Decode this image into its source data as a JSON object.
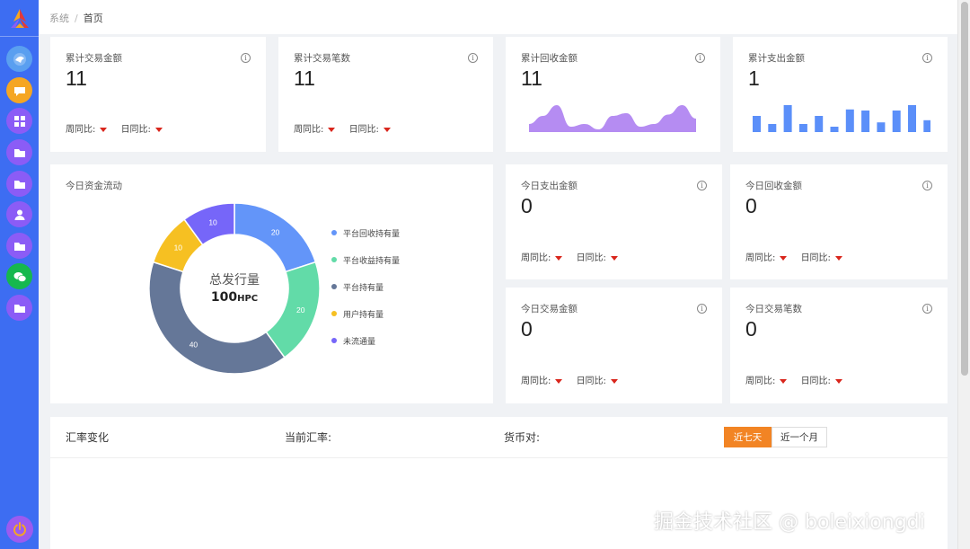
{
  "colors": {
    "sidebar": "#3d6df2",
    "accent_orange": "#f28424",
    "down_arrow": "#d9261c",
    "area_chart": "#b58cf2",
    "bar_chart": "#5b8ff9"
  },
  "sidebar": {
    "items": [
      {
        "icon": "bird-avatar-icon",
        "color": "#5a9ff0"
      },
      {
        "icon": "chat-bubble-icon",
        "color": "#f5a623"
      },
      {
        "icon": "dashboard-grid-icon",
        "color": "#8b5cf6"
      },
      {
        "icon": "folder-icon",
        "color": "#8b5cf6"
      },
      {
        "icon": "folder-icon",
        "color": "#8b5cf6"
      },
      {
        "icon": "user-icon",
        "color": "#8b5cf6"
      },
      {
        "icon": "folder-icon",
        "color": "#8b5cf6"
      },
      {
        "icon": "wechat-icon",
        "color": "#16b84e"
      },
      {
        "icon": "folder-icon",
        "color": "#8b5cf6"
      }
    ],
    "power_icon": "power-icon"
  },
  "breadcrumb": {
    "root": "系统",
    "sep": "/",
    "current": "首页"
  },
  "compare": {
    "week": "周同比:",
    "day": "日同比:"
  },
  "top_cards": [
    {
      "title": "累计交易金额",
      "value": "11"
    },
    {
      "title": "累计交易笔数",
      "value": "11"
    },
    {
      "title": "累计回收金额",
      "value": "11"
    },
    {
      "title": "累计支出金额",
      "value": "1"
    }
  ],
  "mini_cards": [
    {
      "title": "今日支出金额",
      "value": "0"
    },
    {
      "title": "今日回收金额",
      "value": "0"
    },
    {
      "title": "今日交易金额",
      "value": "0"
    },
    {
      "title": "今日交易笔数",
      "value": "0"
    }
  ],
  "donut": {
    "title": "今日资金流动",
    "center_title": "总发行量",
    "center_value": "100",
    "center_unit": "HPC"
  },
  "chart_data": [
    {
      "type": "pie",
      "title": "今日资金流动",
      "series": [
        {
          "name": "平台回收持有量",
          "value": 20,
          "color": "#6395f9"
        },
        {
          "name": "平台收益持有量",
          "value": 20,
          "color": "#62dba8"
        },
        {
          "name": "平台持有量",
          "value": 40,
          "color": "#657798"
        },
        {
          "name": "用户持有量",
          "value": 10,
          "color": "#f6c022"
        },
        {
          "name": "未流通量",
          "value": 10,
          "color": "#7666f9"
        }
      ],
      "legend": "right"
    },
    {
      "type": "bar",
      "values": [
        3,
        1.5,
        5,
        1.5,
        3,
        1,
        4.2,
        4,
        1.8,
        4,
        5,
        2.2
      ],
      "color": "#5b8ff9"
    },
    {
      "type": "area",
      "values": [
        3,
        6,
        10,
        2,
        3,
        1,
        6,
        7,
        2,
        3,
        6.5,
        10,
        5
      ],
      "color": "#b58cf2"
    }
  ],
  "exchange": {
    "title": "汇率变化",
    "current_rate": "当前汇率:",
    "pair": "货币对:",
    "btn_week": "近七天",
    "btn_month": "近一个月"
  },
  "watermark": "掘金技术社区 @ boleixiongdi"
}
